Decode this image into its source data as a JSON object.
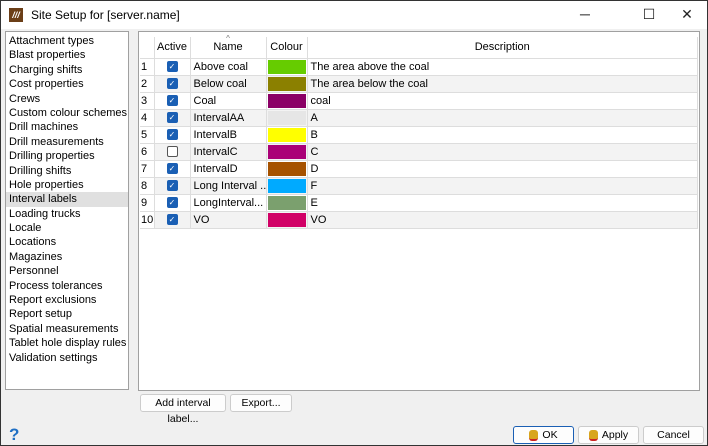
{
  "window": {
    "title": "Site Setup for [server.name]",
    "icon_text": "///",
    "minimize": "─",
    "maximize": "☐",
    "close": "✕"
  },
  "sidebar": {
    "items": [
      "Attachment types",
      "Blast properties",
      "Charging shifts",
      "Cost properties",
      "Crews",
      "Custom colour schemes",
      "Drill machines",
      "Drill measurements",
      "Drilling properties",
      "Drilling shifts",
      "Hole properties",
      "Interval labels",
      "Loading trucks",
      "Locale",
      "Locations",
      "Magazines",
      "Personnel",
      "Process tolerances",
      "Report exclusions",
      "Report setup",
      "Spatial measurements",
      "Tablet hole display rules",
      "Validation settings"
    ],
    "selected": "Interval labels"
  },
  "table": {
    "headers": {
      "active": "Active",
      "name": "Name",
      "colour": "Colour",
      "description": "Description"
    },
    "rows": [
      {
        "n": "1",
        "active": true,
        "name": "Above coal",
        "colour": "#66cc00",
        "description": "The area above the coal"
      },
      {
        "n": "2",
        "active": true,
        "name": "Below coal",
        "colour": "#8b8000",
        "description": "The area below the coal"
      },
      {
        "n": "3",
        "active": true,
        "name": "Coal",
        "colour": "#8b0066",
        "description": "coal"
      },
      {
        "n": "4",
        "active": true,
        "name": "IntervalAA",
        "colour": "#e6e6e6",
        "description": "A"
      },
      {
        "n": "5",
        "active": true,
        "name": "IntervalB",
        "colour": "#ffff00",
        "description": "B"
      },
      {
        "n": "6",
        "active": false,
        "name": "IntervalC",
        "colour": "#aa0077",
        "description": "C"
      },
      {
        "n": "7",
        "active": true,
        "name": "IntervalD",
        "colour": "#a65200",
        "description": "D"
      },
      {
        "n": "8",
        "active": true,
        "name": "Long Interval ...",
        "colour": "#00aaff",
        "description": "F"
      },
      {
        "n": "9",
        "active": true,
        "name": "LongInterval...",
        "colour": "#7ba06e",
        "description": "E"
      },
      {
        "n": "10",
        "active": true,
        "name": "VO",
        "colour": "#d10066",
        "description": "VO"
      }
    ]
  },
  "buttons": {
    "add": "Add interval label...",
    "export": "Export...",
    "ok": "OK",
    "apply": "Apply",
    "cancel": "Cancel",
    "help": "?"
  }
}
